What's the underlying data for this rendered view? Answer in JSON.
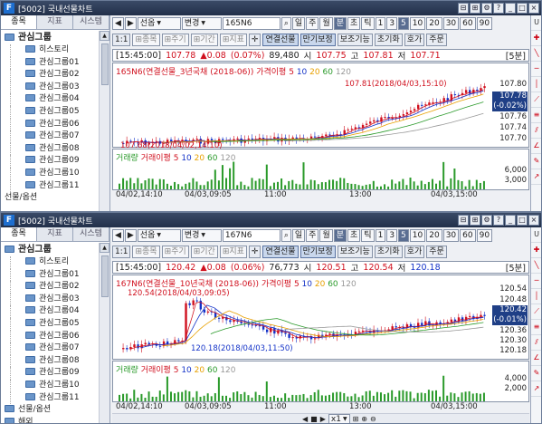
{
  "windows": [
    {
      "title": "[5002] 국내선물차트",
      "left_tabs": [
        "종목",
        "지표",
        "시스템"
      ],
      "tree_root": "관심그룹",
      "tree_items": [
        "히스토리",
        "관심그룹01",
        "관심그룹02",
        "관심그룹03",
        "관심그룹04",
        "관심그룹05",
        "관심그룹06",
        "관심그룹07",
        "관심그룹08",
        "관심그룹09",
        "관심그룹10",
        "관심그룹11"
      ],
      "tree_tail": "선물/옵션",
      "toolbar": {
        "market": "선옵",
        "change": "변경",
        "code": "165N6",
        "periods": [
          "일",
          "주",
          "월",
          "분",
          "초",
          "틱"
        ],
        "intervals": [
          "1",
          "3",
          "5",
          "10",
          "20",
          "30",
          "60",
          "90"
        ],
        "selected_interval": "5"
      },
      "toolbar2": [
        "1:1",
        "종목",
        "주기",
        "기간",
        "지표"
      ],
      "toolbar2_right": [
        "연결선물",
        "만기보정",
        "보조기능",
        "초기화",
        "호가",
        "주문"
      ],
      "info": {
        "time": "[15:45:00]",
        "price": "107.78",
        "change": "▲0.08",
        "pct": "(0.07%)",
        "volume": "89,480",
        "high_label": "시",
        "open": "107.75",
        "h_label": "고",
        "high": "107.81",
        "l_label": "저",
        "low": "107.71",
        "period": "[5분]"
      },
      "legend": {
        "name": "165N6(연결선물_3년국채 (2018-06))",
        "ma_label": "가격이평",
        "ma": [
          "5",
          "10",
          "20",
          "60",
          "120"
        ]
      },
      "annotations": {
        "max": "107.81(2018/04/03,15:10)",
        "min": "107.68(2018/04/02,14:10)"
      },
      "yaxis": [
        "107.80",
        "107.76",
        "107.74",
        "107.72",
        "107.70",
        "107.68"
      ],
      "last": {
        "value": "107.78",
        "delta": "(-0.02%)"
      },
      "vol_legend": {
        "label": "거래량",
        "ma_label": "거래이평",
        "ma": [
          "5",
          "10",
          "20",
          "60",
          "120"
        ]
      },
      "vol_yaxis": [
        "6,000",
        "3,000",
        "0"
      ],
      "xaxis": [
        "04/02,14:10",
        "04/03,09:05",
        "11:00",
        "13:00",
        "04/03,15:00"
      ]
    },
    {
      "title": "[5002] 국내선물차트",
      "left_tabs": [
        "종목",
        "지표",
        "시스템"
      ],
      "tree_root": "관심그룹",
      "tree_items": [
        "히스토리",
        "관심그룹01",
        "관심그룹02",
        "관심그룹03",
        "관심그룹04",
        "관심그룹05",
        "관심그룹06",
        "관심그룹07",
        "관심그룹08",
        "관심그룹09",
        "관심그룹10",
        "관심그룹11"
      ],
      "tree_tail": "선물/옵션",
      "tree_tail2": "해외",
      "toolbar": {
        "market": "선옵",
        "change": "변경",
        "code": "167N6",
        "periods": [
          "일",
          "주",
          "월",
          "분",
          "초",
          "틱"
        ],
        "intervals": [
          "1",
          "3",
          "5",
          "10",
          "20",
          "30",
          "60",
          "90"
        ],
        "selected_interval": "5"
      },
      "toolbar2": [
        "1:1",
        "종목",
        "주기",
        "기간",
        "지표"
      ],
      "toolbar2_right": [
        "연결선물",
        "만기보정",
        "보조기능",
        "초기화",
        "호가",
        "주문"
      ],
      "info": {
        "time": "[15:45:00]",
        "price": "120.42",
        "change": "▲0.08",
        "pct": "(0.06%)",
        "volume": "76,773",
        "high_label": "시",
        "open": "120.51",
        "h_label": "고",
        "high": "120.54",
        "l_label": "저",
        "low": "120.18",
        "period": "[5분]"
      },
      "legend": {
        "name": "167N6(연결선물_10년국채 (2018-06))",
        "ma_label": "가격이평",
        "ma": [
          "5",
          "10",
          "20",
          "60",
          "120"
        ]
      },
      "annotations": {
        "max": "120.54(2018/04/03,09:05)",
        "min": "120.18(2018/04/03,11:50)"
      },
      "yaxis": [
        "120.54",
        "120.48",
        "120.42",
        "120.36",
        "120.30",
        "120.24",
        "120.18"
      ],
      "last": {
        "value": "120.42",
        "delta": "(-0.01%)"
      },
      "vol_legend": {
        "label": "거래량",
        "ma_label": "거래이평",
        "ma": [
          "5",
          "10",
          "20",
          "60",
          "120"
        ]
      },
      "vol_yaxis": [
        "4,000",
        "2,000",
        "0"
      ],
      "xaxis": [
        "04/02,14:10",
        "04/03,09:05",
        "11:00",
        "13:00",
        "04/03,15:00"
      ],
      "bottom_zoom": "x1"
    }
  ],
  "colors": {
    "candle_up": "#d0101e",
    "candle_down": "#1433c8",
    "ma5": "#d0101e",
    "ma10": "#1433c8",
    "ma20": "#e8a000",
    "ma60": "#2a9a2a",
    "ma120": "#999999"
  }
}
